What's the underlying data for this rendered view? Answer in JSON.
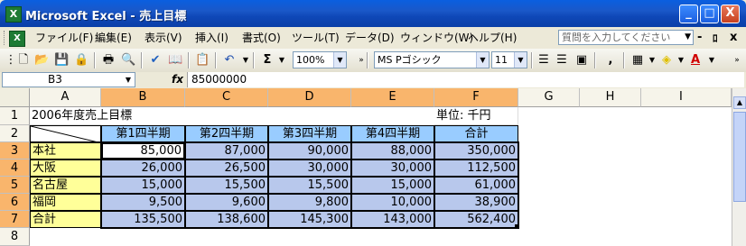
{
  "window": {
    "title": "Microsoft Excel - 売上目標",
    "app_icon": "X",
    "minimize": "_",
    "maximize": "□",
    "close": "X"
  },
  "menu": {
    "items": [
      "ファイル(F)",
      "編集(E)",
      "表示(V)",
      "挿入(I)",
      "書式(O)",
      "ツール(T)",
      "データ(D)",
      "ウィンドウ(W)",
      "ヘルプ(H)"
    ],
    "help_placeholder": "質問を入力してください",
    "win_ctrls": [
      "-",
      "ﾛ",
      "x"
    ]
  },
  "toolbar": {
    "zoom": "100%",
    "font": "MS Pゴシック",
    "font_size": "11",
    "sum": "Σ",
    "underline_a": "A"
  },
  "formula_bar": {
    "name_box": "B3",
    "fx": "fx",
    "value": "85000000"
  },
  "columns": [
    "A",
    "B",
    "C",
    "D",
    "E",
    "F",
    "G",
    "H",
    "I"
  ],
  "rows": [
    "1",
    "2",
    "3",
    "4",
    "5",
    "6",
    "7",
    "8"
  ],
  "sheet": {
    "a1": "2006年度売上目標",
    "f1": "単位: 千円",
    "headers": [
      "第1四半期",
      "第2四半期",
      "第3四半期",
      "第4四半期",
      "合計"
    ],
    "data_rows": [
      {
        "name": "本社",
        "values": [
          "85,000",
          "87,000",
          "90,000",
          "88,000",
          "350,000"
        ]
      },
      {
        "name": "大阪",
        "values": [
          "26,000",
          "26,500",
          "30,000",
          "30,000",
          "112,500"
        ]
      },
      {
        "name": "名古屋",
        "values": [
          "15,000",
          "15,500",
          "15,500",
          "15,000",
          "61,000"
        ]
      },
      {
        "name": "福岡",
        "values": [
          "9,500",
          "9,600",
          "9,800",
          "10,000",
          "38,900"
        ]
      },
      {
        "name": "合計",
        "values": [
          "135,500",
          "138,600",
          "145,300",
          "143,000",
          "562,400"
        ]
      }
    ]
  },
  "colors": {
    "title_bar": "#0A5FE0",
    "selected_header": "#F9B56C",
    "header_fill": "#99CCFF",
    "name_fill": "#FFFF99",
    "data_fill": "#B8C8EC"
  }
}
